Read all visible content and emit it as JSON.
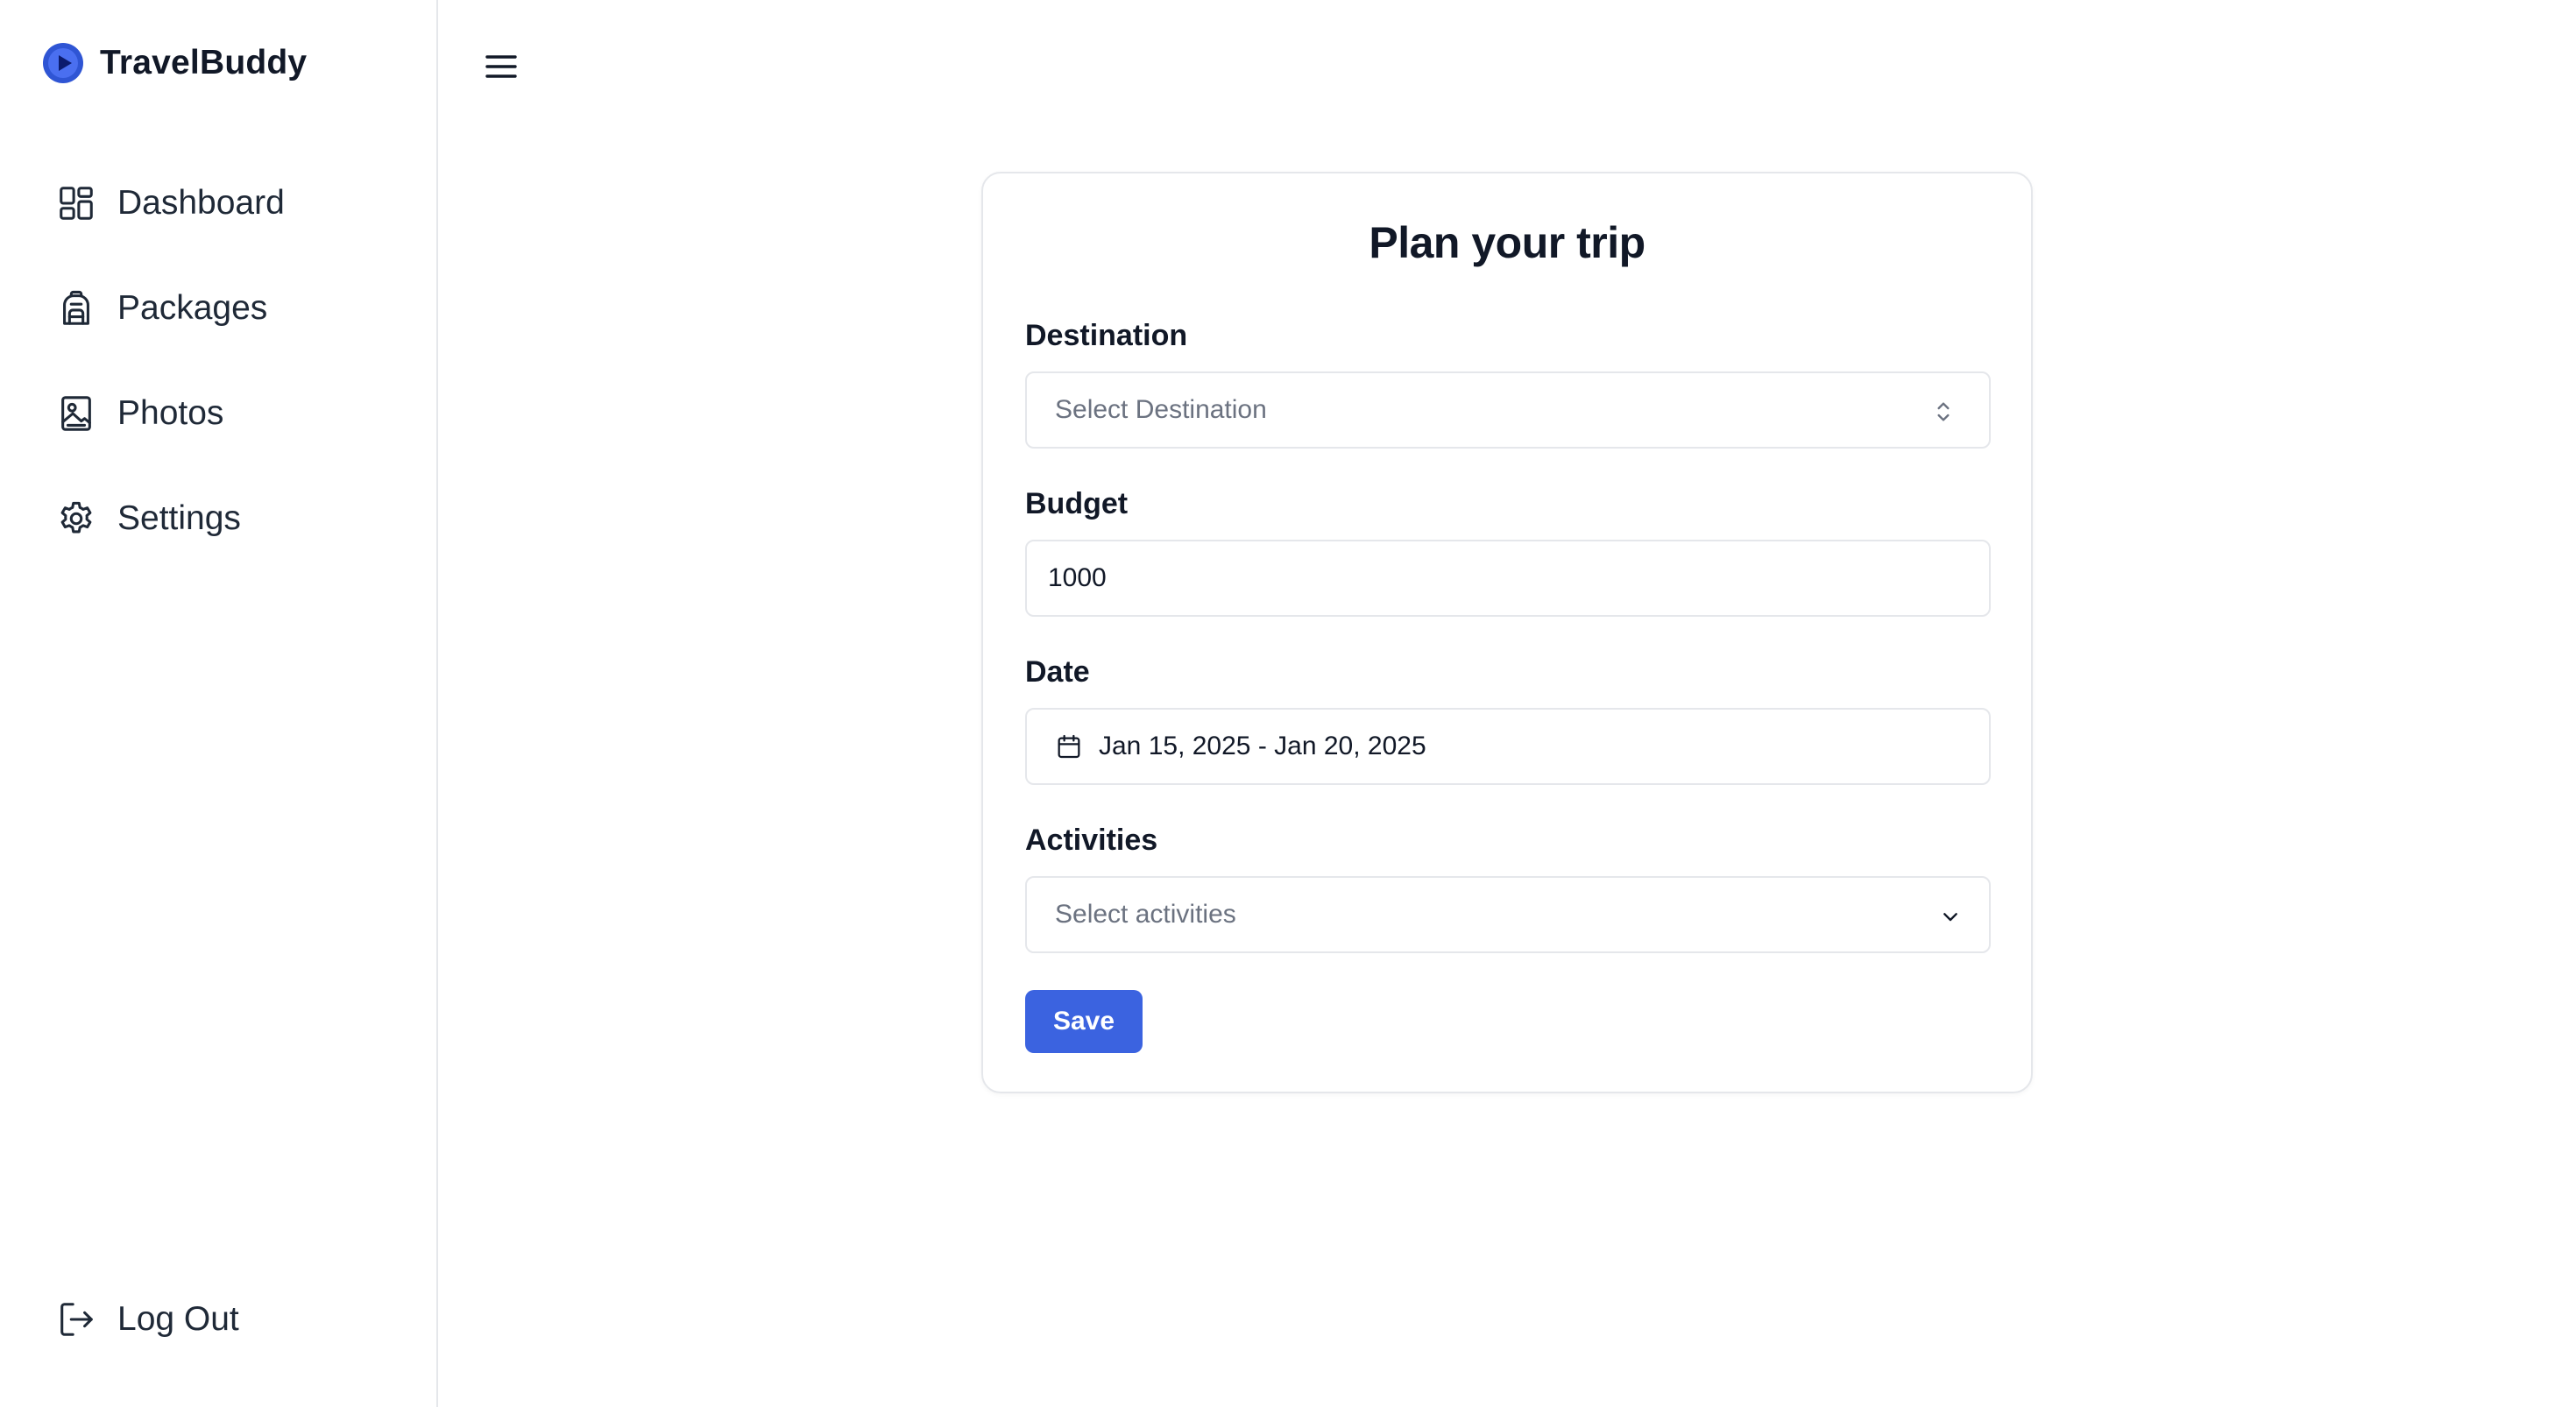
{
  "brand": {
    "name": "TravelBuddy"
  },
  "sidebar": {
    "items": [
      {
        "label": "Dashboard",
        "icon": "dashboard-icon"
      },
      {
        "label": "Packages",
        "icon": "backpack-icon"
      },
      {
        "label": "Photos",
        "icon": "photo-icon"
      },
      {
        "label": "Settings",
        "icon": "gear-icon"
      }
    ],
    "logout": {
      "label": "Log Out",
      "icon": "logout-icon"
    }
  },
  "form": {
    "title": "Plan your trip",
    "destination": {
      "label": "Destination",
      "placeholder": "Select Destination"
    },
    "budget": {
      "label": "Budget",
      "value": "1000"
    },
    "date": {
      "label": "Date",
      "value": "Jan 15, 2025 - Jan 20, 2025"
    },
    "activities": {
      "label": "Activities",
      "placeholder": "Select activities"
    },
    "save_label": "Save"
  },
  "colors": {
    "accent": "#3b63e0",
    "brand_logo": "#2f55d4",
    "border": "#e5e7eb"
  }
}
